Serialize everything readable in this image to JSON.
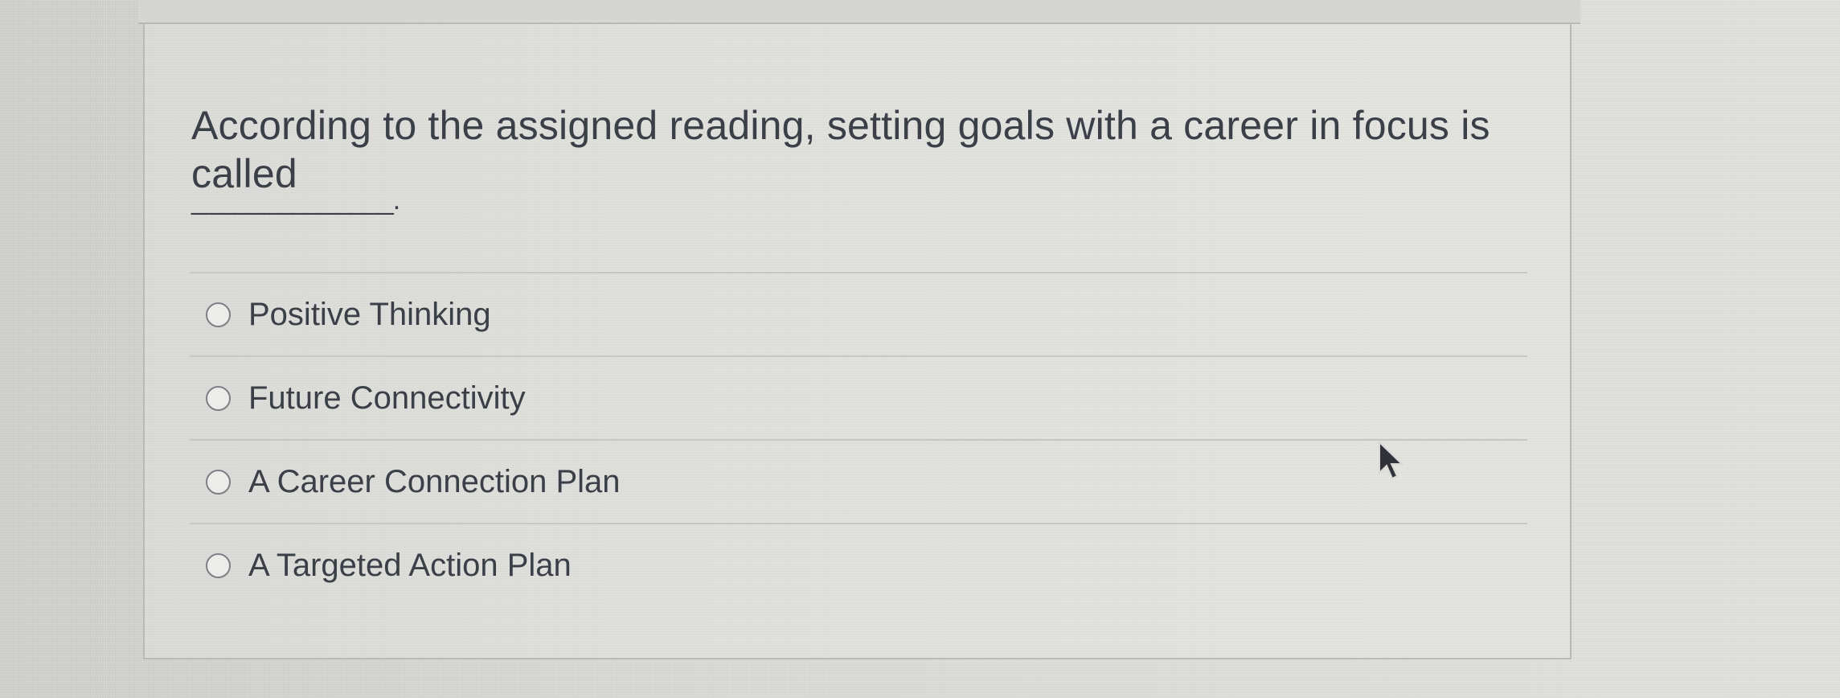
{
  "question": {
    "text": "According to the assigned reading, setting goals with a career in focus is called",
    "blank": "______________."
  },
  "answers": [
    {
      "label": "Positive Thinking",
      "selected": false
    },
    {
      "label": "Future Connectivity",
      "selected": false
    },
    {
      "label": "A Career Connection Plan",
      "selected": false
    },
    {
      "label": "A Targeted Action Plan",
      "selected": false
    }
  ],
  "icons": {
    "radio": "radio-button-icon",
    "cursor": "mouse-pointer-icon"
  },
  "colors": {
    "text": "#3b4048",
    "border": "#b9b9b5",
    "radio_border": "#7d8086"
  }
}
